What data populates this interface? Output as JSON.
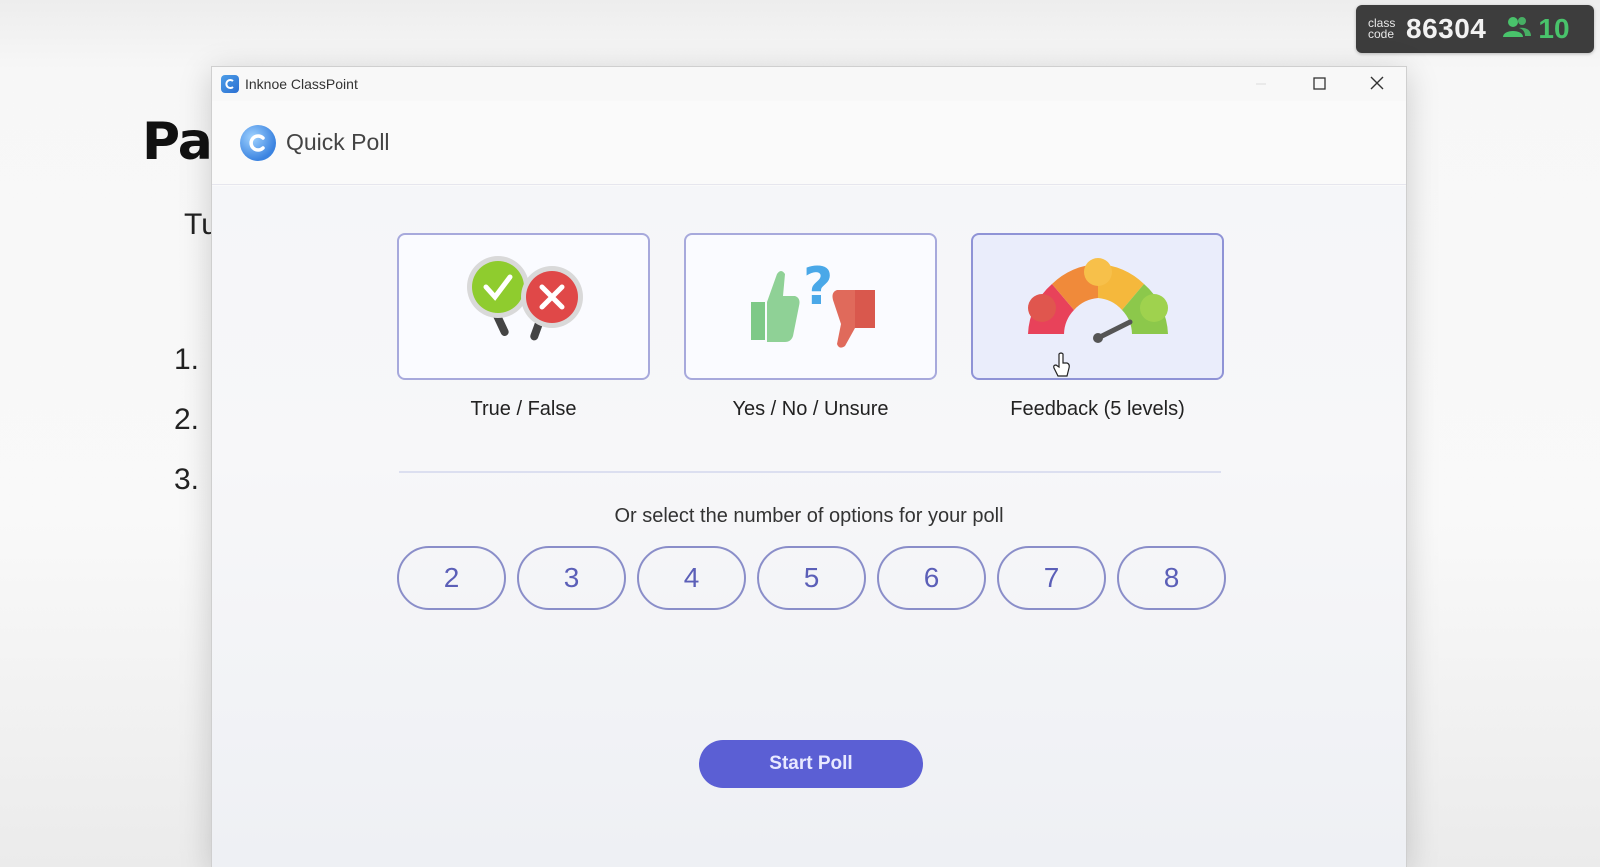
{
  "slide": {
    "title": "Pa",
    "subtitle": "Tu",
    "list": [
      "1.",
      "2.",
      "3."
    ]
  },
  "class_badge": {
    "label_line1": "class",
    "label_line2": "code",
    "code": "86304",
    "participants": "10",
    "participants_icon": "users-icon",
    "accent_color": "#49c36b"
  },
  "window": {
    "app_title": "Inknoe ClassPoint",
    "controls": {
      "minimize": "minimize-icon",
      "maximize": "maximize-icon",
      "close": "close-icon"
    }
  },
  "header": {
    "title": "Quick Poll"
  },
  "poll_types": [
    {
      "label": "True / False",
      "icon": "true-false-icon",
      "selected": false
    },
    {
      "label": "Yes / No / Unsure",
      "icon": "yes-no-unsure-icon",
      "selected": false
    },
    {
      "label": "Feedback (5 levels)",
      "icon": "feedback-gauge-icon",
      "selected": true
    }
  ],
  "options": {
    "label": "Or select the number of options for your poll",
    "numbers": [
      "2",
      "3",
      "4",
      "5",
      "6",
      "7",
      "8"
    ]
  },
  "start_button": {
    "label": "Start Poll",
    "color": "#5b5fd4"
  }
}
